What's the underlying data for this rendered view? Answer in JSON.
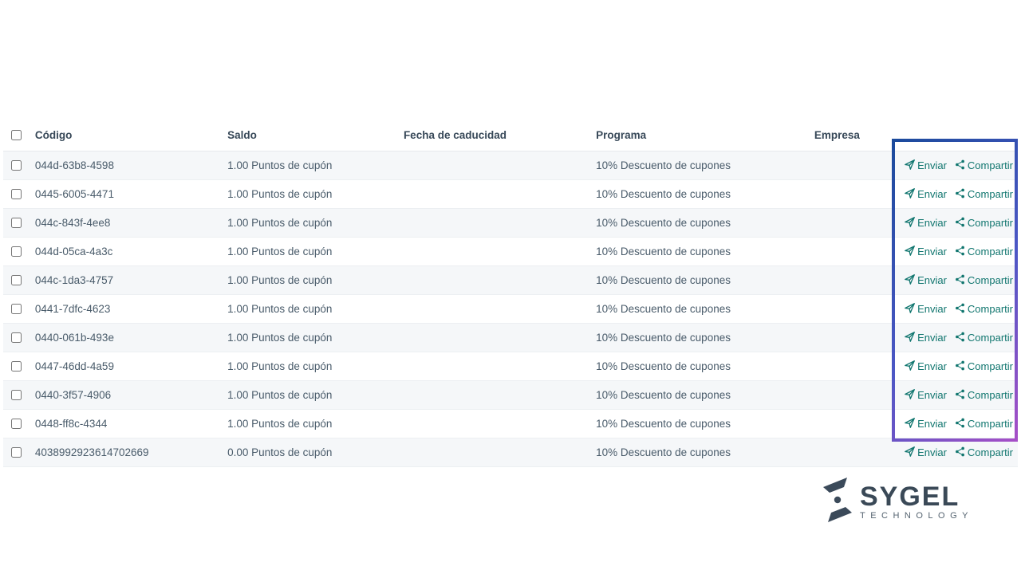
{
  "columns": {
    "codigo": "Código",
    "saldo": "Saldo",
    "caducidad": "Fecha de caducidad",
    "programa": "Programa",
    "empresa": "Empresa"
  },
  "action_labels": {
    "enviar": "Enviar",
    "compartir": "Compartir"
  },
  "rows": [
    {
      "codigo": "044d-63b8-4598",
      "saldo": "1.00 Puntos de cupón",
      "caducidad": "",
      "programa": "10% Descuento de cupones",
      "empresa": ""
    },
    {
      "codigo": "0445-6005-4471",
      "saldo": "1.00 Puntos de cupón",
      "caducidad": "",
      "programa": "10% Descuento de cupones",
      "empresa": ""
    },
    {
      "codigo": "044c-843f-4ee8",
      "saldo": "1.00 Puntos de cupón",
      "caducidad": "",
      "programa": "10% Descuento de cupones",
      "empresa": ""
    },
    {
      "codigo": "044d-05ca-4a3c",
      "saldo": "1.00 Puntos de cupón",
      "caducidad": "",
      "programa": "10% Descuento de cupones",
      "empresa": ""
    },
    {
      "codigo": "044c-1da3-4757",
      "saldo": "1.00 Puntos de cupón",
      "caducidad": "",
      "programa": "10% Descuento de cupones",
      "empresa": ""
    },
    {
      "codigo": "0441-7dfc-4623",
      "saldo": "1.00 Puntos de cupón",
      "caducidad": "",
      "programa": "10% Descuento de cupones",
      "empresa": ""
    },
    {
      "codigo": "0440-061b-493e",
      "saldo": "1.00 Puntos de cupón",
      "caducidad": "",
      "programa": "10% Descuento de cupones",
      "empresa": ""
    },
    {
      "codigo": "0447-46dd-4a59",
      "saldo": "1.00 Puntos de cupón",
      "caducidad": "",
      "programa": "10% Descuento de cupones",
      "empresa": ""
    },
    {
      "codigo": "0440-3f57-4906",
      "saldo": "1.00 Puntos de cupón",
      "caducidad": "",
      "programa": "10% Descuento de cupones",
      "empresa": ""
    },
    {
      "codigo": "0448-ff8c-4344",
      "saldo": "1.00 Puntos de cupón",
      "caducidad": "",
      "programa": "10% Descuento de cupones",
      "empresa": ""
    },
    {
      "codigo": "4038992923614702669",
      "saldo": "0.00 Puntos de cupón",
      "caducidad": "",
      "programa": "10% Descuento de cupones",
      "empresa": ""
    }
  ],
  "logo": {
    "main": "SYGEL",
    "sub": "TECHNOLOGY"
  }
}
